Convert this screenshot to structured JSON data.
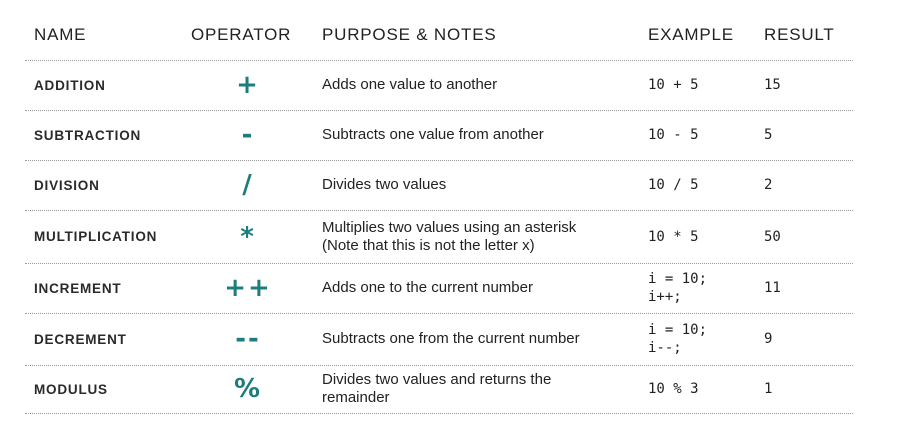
{
  "headers": {
    "name": "NAME",
    "operator": "OPERATOR",
    "notes": "PURPOSE & NOTES",
    "example": "EXAMPLE",
    "result": "RESULT"
  },
  "rows": [
    {
      "name": "ADDITION",
      "operator": "+",
      "notes": [
        "Adds one value to another"
      ],
      "example": [
        "10 + 5"
      ],
      "result": "15"
    },
    {
      "name": "SUBTRACTION",
      "operator": "-",
      "notes": [
        "Subtracts one value from another"
      ],
      "example": [
        "10 - 5"
      ],
      "result": "5"
    },
    {
      "name": "DIVISION",
      "operator": "/",
      "notes": [
        "Divides two values"
      ],
      "example": [
        "10 / 5"
      ],
      "result": "2"
    },
    {
      "name": "MULTIPLICATION",
      "operator": "*",
      "notes": [
        "Multiplies two values using an asterisk",
        "(Note that this is not the letter x)"
      ],
      "example": [
        "10 * 5"
      ],
      "result": "50"
    },
    {
      "name": "INCREMENT",
      "operator": "++",
      "notes": [
        "Adds one to the current number"
      ],
      "example": [
        "i = 10;",
        "i++;"
      ],
      "result": "11"
    },
    {
      "name": "DECREMENT",
      "operator": "--",
      "notes": [
        "Subtracts one from the current number"
      ],
      "example": [
        "i = 10;",
        "i--;"
      ],
      "result": "9"
    },
    {
      "name": "MODULUS",
      "operator": "%",
      "notes": [
        "Divides two values and returns the",
        "remainder"
      ],
      "example": [
        "10 % 3"
      ],
      "result": "1"
    }
  ],
  "colors": {
    "operator": "#1d7d7d",
    "divider": "#9a9a9a",
    "text": "#222222"
  }
}
